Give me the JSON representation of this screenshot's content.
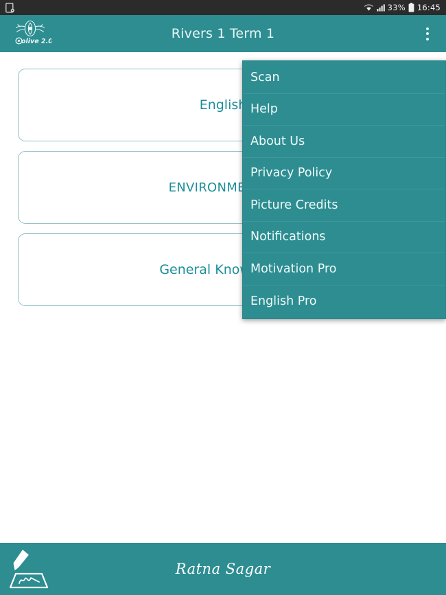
{
  "status_bar": {
    "screenshot_icon": "screenshot-icon",
    "wifi_icon": "wifi-icon",
    "signal_icon": "signal-bars-icon",
    "battery_percent": "33%",
    "battery_icon": "battery-icon",
    "clock": "16:45"
  },
  "toolbar": {
    "logo_name": "olive-2.0-logo",
    "logo_text": "olive 2.0",
    "title": "Rivers 1 Term 1",
    "overflow_icon": "overflow-menu-icon"
  },
  "cards": [
    {
      "label": "English",
      "caps": false
    },
    {
      "label": "ENVIRONMENTAL",
      "caps": true
    },
    {
      "label": "General Knowledge",
      "caps": false
    }
  ],
  "menu": {
    "items": [
      {
        "label": "Scan"
      },
      {
        "label": "Help"
      },
      {
        "label": "About Us"
      },
      {
        "label": "Privacy Policy"
      },
      {
        "label": "Picture Credits"
      },
      {
        "label": "Notifications"
      },
      {
        "label": "Motivation Pro"
      },
      {
        "label": "English Pro"
      }
    ]
  },
  "footer": {
    "logo_name": "ratna-sagar-pen-logo",
    "brand": "Ratna Sagar"
  },
  "colors": {
    "teal": "#2d8d91",
    "status_bar": "#2b2b2b",
    "card_text": "#1c8e99",
    "card_border": "#8fbfc4",
    "menu_divider": "#3e999c",
    "page_bg": "#ffffff"
  }
}
